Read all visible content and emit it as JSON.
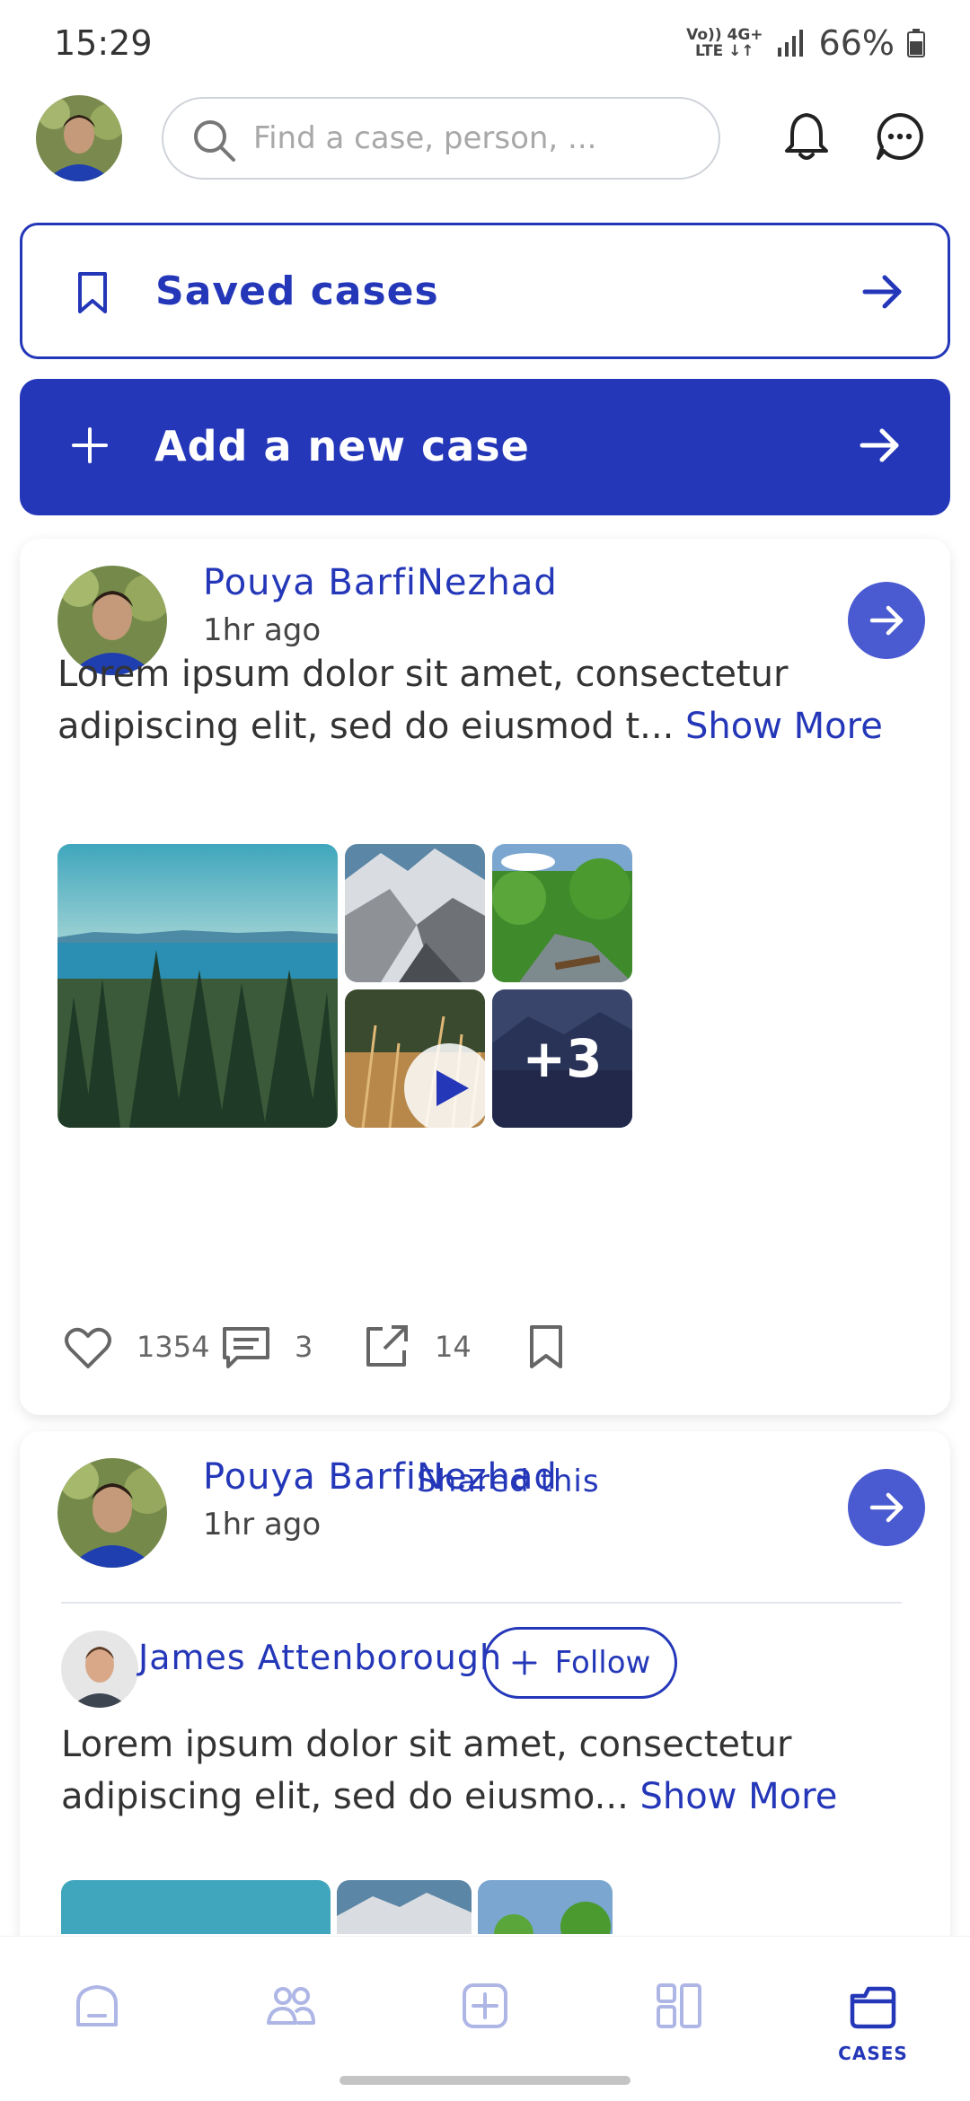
{
  "status_bar": {
    "time": "15:29",
    "network_top": "Vo)) 4G+",
    "network_bottom": "LTE ↓↑",
    "battery": "66%"
  },
  "search": {
    "placeholder": "Find a case, person, ..."
  },
  "buttons": {
    "saved_cases": "Saved cases",
    "add_case": "Add a new case"
  },
  "posts": [
    {
      "author": "Pouya BarfiNezhad",
      "time": "1hr ago",
      "text": "Lorem ipsum dolor sit amet, consectetur adipiscing elit, sed do eiusmod t...",
      "show_more": "Show More",
      "extra_media": "+3",
      "likes": "1354",
      "comments": "3",
      "shares": "14"
    },
    {
      "author": "Pouya BarfiNezhad",
      "shared_label": "Shared this",
      "time": "1hr ago",
      "original_author": "James Attenborough",
      "follow": "Follow",
      "text": "Lorem ipsum dolor sit amet, consectetur adipiscing elit, sed do eiusmo...",
      "show_more": "Show More"
    }
  ],
  "nav": {
    "active_label": "CASES"
  },
  "colors": {
    "primary": "#2437b8",
    "accent": "#4a5ad0",
    "nav_inactive": "#aeb6e6"
  }
}
